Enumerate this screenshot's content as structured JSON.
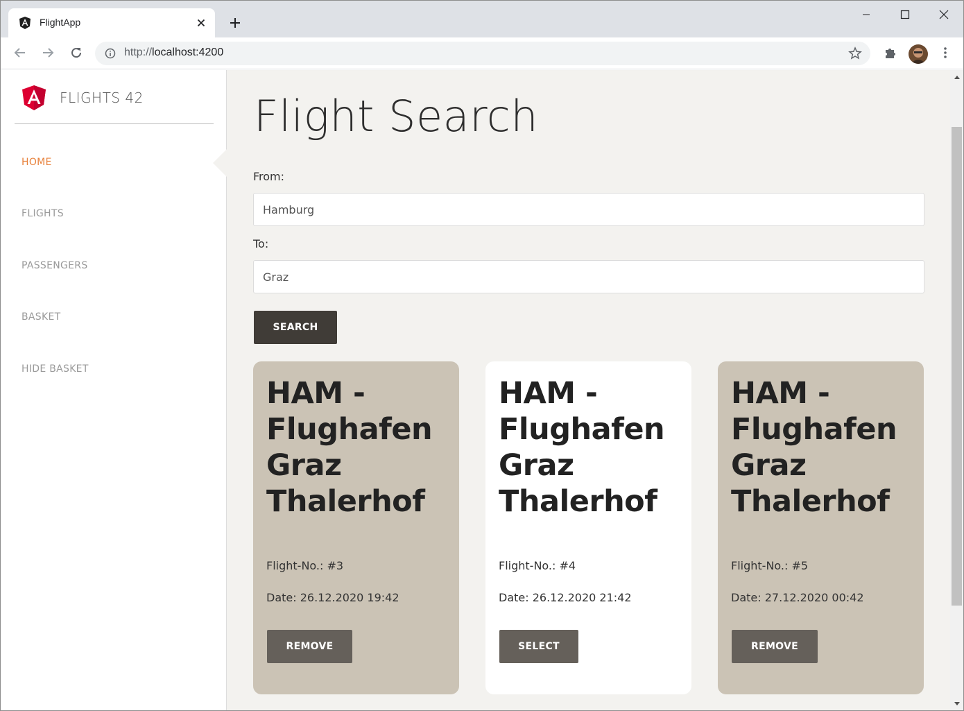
{
  "browser": {
    "tab_title": "FlightApp",
    "url_protocol": "http://",
    "url_host": "localhost:4200"
  },
  "app": {
    "brand": "FLIGHTS 42",
    "nav": [
      {
        "label": "HOME",
        "active": true
      },
      {
        "label": "FLIGHTS",
        "active": false
      },
      {
        "label": "PASSENGERS",
        "active": false
      },
      {
        "label": "BASKET",
        "active": false
      },
      {
        "label": "HIDE BASKET",
        "active": false
      }
    ]
  },
  "search": {
    "title": "Flight Search",
    "from_label": "From:",
    "from_value": "Hamburg",
    "to_label": "To:",
    "to_value": "Graz",
    "button_label": "SEARCH"
  },
  "flights": [
    {
      "title": "HAM - Flughafen Graz Thalerhof",
      "number": "Flight-No.: #3",
      "date": "Date: 26.12.2020 19:42",
      "button": "REMOVE",
      "selected": true
    },
    {
      "title": "HAM - Flughafen Graz Thalerhof",
      "number": "Flight-No.: #4",
      "date": "Date: 26.12.2020 21:42",
      "button": "SELECT",
      "selected": false
    },
    {
      "title": "HAM - Flughafen Graz Thalerhof",
      "number": "Flight-No.: #5",
      "date": "Date: 27.12.2020 00:42",
      "button": "REMOVE",
      "selected": true
    }
  ],
  "colors": {
    "accent": "#e8823c",
    "page_bg": "#f3f2ef",
    "card_selected": "#cbc3b5",
    "card_plain": "#ffffff",
    "search_button": "#403c37",
    "card_button": "#65605a"
  }
}
